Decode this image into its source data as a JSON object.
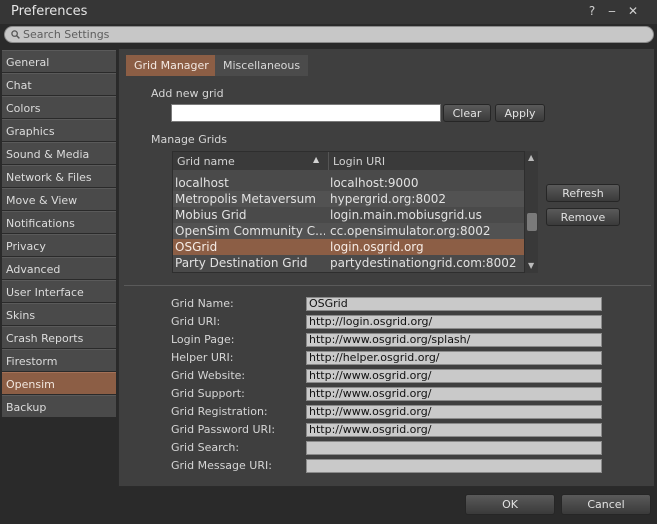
{
  "window": {
    "title": "Preferences",
    "help_glyph": "?",
    "minimize_glyph": "‒",
    "close_glyph": "✕"
  },
  "search": {
    "placeholder": "Search Settings"
  },
  "sidebar": {
    "items": [
      {
        "label": "General"
      },
      {
        "label": "Chat"
      },
      {
        "label": "Colors"
      },
      {
        "label": "Graphics"
      },
      {
        "label": "Sound & Media"
      },
      {
        "label": "Network & Files"
      },
      {
        "label": "Move & View"
      },
      {
        "label": "Notifications"
      },
      {
        "label": "Privacy"
      },
      {
        "label": "Advanced"
      },
      {
        "label": "User Interface"
      },
      {
        "label": "Skins"
      },
      {
        "label": "Crash Reports"
      },
      {
        "label": "Firestorm"
      },
      {
        "label": "Opensim"
      },
      {
        "label": "Backup"
      }
    ],
    "active": "Opensim"
  },
  "tabs": [
    {
      "label": "Grid Manager"
    },
    {
      "label": "Miscellaneous"
    }
  ],
  "add_grid": {
    "label": "Add new grid",
    "value": "",
    "clear_label": "Clear",
    "apply_label": "Apply"
  },
  "manage": {
    "label": "Manage Grids",
    "columns": [
      "Grid name",
      "Login URI"
    ],
    "sort_glyph": "▲",
    "rows": [
      {
        "name": "localhost",
        "uri": "localhost:9000"
      },
      {
        "name": "Metropolis Metaversum",
        "uri": "hypergrid.org:8002"
      },
      {
        "name": "Mobius Grid",
        "uri": "login.main.mobiusgrid.us"
      },
      {
        "name": "OpenSim Community C...",
        "uri": "cc.opensimulator.org:8002"
      },
      {
        "name": "OSGrid",
        "uri": "login.osgrid.org"
      },
      {
        "name": "Party Destination Grid",
        "uri": "partydestinationgrid.com:8002"
      }
    ],
    "selected": "OSGrid",
    "refresh_label": "Refresh",
    "remove_label": "Remove"
  },
  "details": [
    {
      "label": "Grid Name:",
      "value": "OSGrid"
    },
    {
      "label": "Grid URI:",
      "value": "http://login.osgrid.org/"
    },
    {
      "label": "Login Page:",
      "value": "http://www.osgrid.org/splash/"
    },
    {
      "label": "Helper URI:",
      "value": "http://helper.osgrid.org/"
    },
    {
      "label": "Grid Website:",
      "value": "http://www.osgrid.org/"
    },
    {
      "label": "Grid Support:",
      "value": "http://www.osgrid.org/"
    },
    {
      "label": "Grid Registration:",
      "value": "http://www.osgrid.org/"
    },
    {
      "label": "Grid Password URI:",
      "value": "http://www.osgrid.org/"
    },
    {
      "label": "Grid Search:",
      "value": ""
    },
    {
      "label": "Grid Message URI:",
      "value": ""
    }
  ],
  "footer": {
    "ok_label": "OK",
    "cancel_label": "Cancel"
  },
  "colors": {
    "accent": "#8c5e45",
    "panel": "#3f3f3f",
    "background": "#2a2a2a"
  }
}
